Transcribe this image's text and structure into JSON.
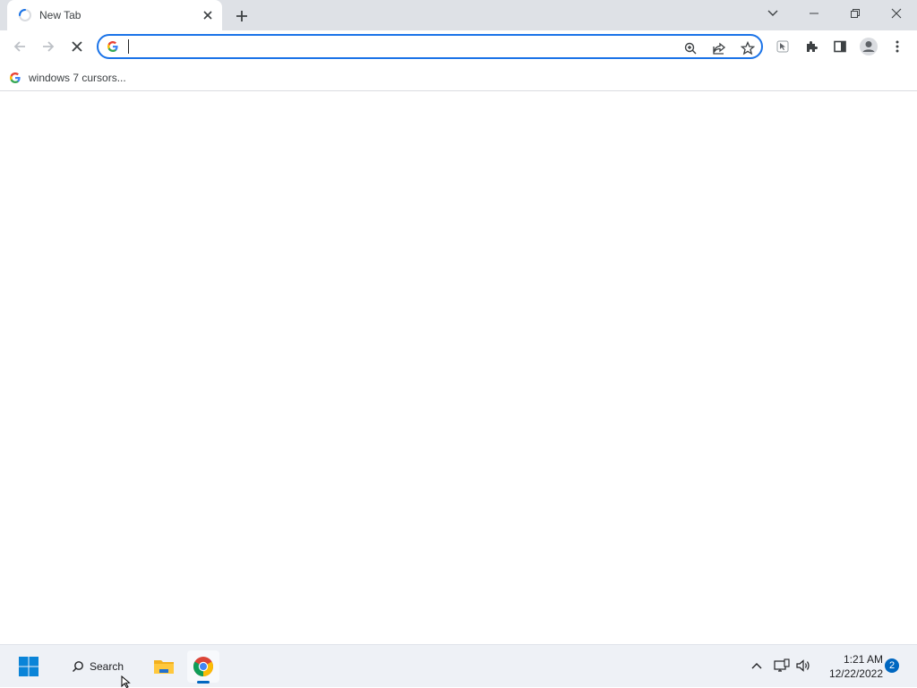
{
  "tab": {
    "title": "New Tab"
  },
  "omnibox": {
    "value": "",
    "placeholder": ""
  },
  "bookmarks": [
    {
      "label": "windows 7 cursors..."
    }
  ],
  "taskbar": {
    "search_label": "Search",
    "time": "1:21 AM",
    "date": "12/22/2022",
    "notification_count": "2"
  },
  "colors": {
    "accent": "#1a73e8",
    "tabstrip": "#dee1e6",
    "taskbar": "#eef1f6",
    "windows_blue": "#0067c0"
  }
}
